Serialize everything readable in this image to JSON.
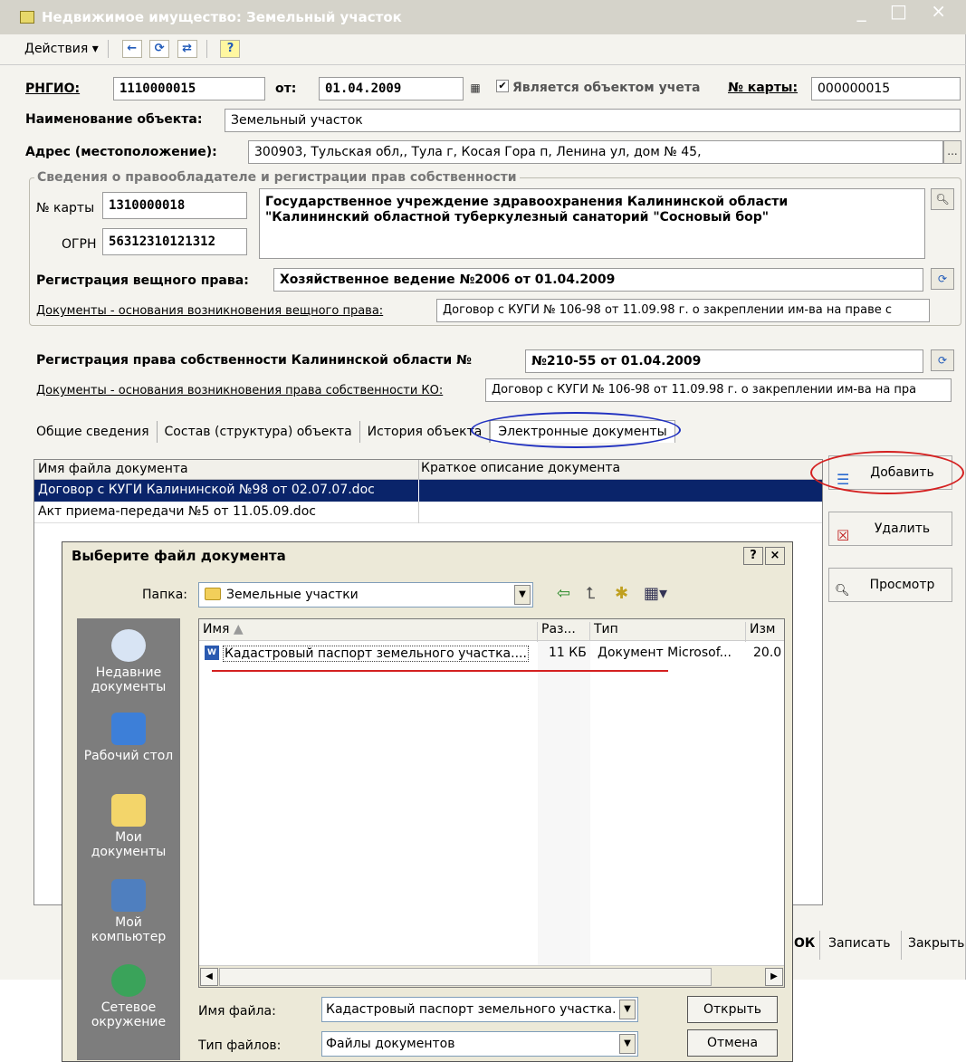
{
  "window": {
    "title": "Недвижимое имущество: Земельный участок",
    "controls": "_ □ ×",
    "actions_menu": "Действия ▾"
  },
  "header": {
    "rngio_label": "РНГИО:",
    "rngio_value": "1110000015",
    "from_label": "от:",
    "date_value": "01.04.2009",
    "accounting_checkbox": "Является объектом учета",
    "card_label": "№ карты:",
    "card_value": "000000015",
    "name_label": "Наименование объекта:",
    "name_value": "Земельный участок",
    "address_label": "Адрес (местоположение):",
    "address_value": "300903, Тульская обл,, Тула г, Косая Гора п, Ленина ул, дом № 45,",
    "ellipsis": "..."
  },
  "rightholder": {
    "legend": "Сведения о правообладателе и регистрации прав собственности",
    "card_label": "№ карты",
    "card_value": "1310000018",
    "ogrn_label": "ОГРН",
    "ogrn_value": "56312310121312",
    "org_line1": "Государственное учреждение здравоохранения Калининской области",
    "org_line2": "\"Калининский областной туберкулезный санаторий \"Сосновый бор\"",
    "real_right_label": "Регистрация вещного права:",
    "real_right_value": "Хозяйственное ведение №2006 от 01.04.2009",
    "docs_real_label": "Документы - основания возникновения вещного права:",
    "docs_real_value": "Договор с КУГИ № 106-98 от 11.09.98 г. о закреплении им-ва на праве с"
  },
  "ownership": {
    "label": "Регистрация права собственности Калининской области №",
    "value": "№210-55 от 01.04.2009",
    "docs_label": "Документы - основания возникновения права собственности КО:",
    "docs_value": "Договор с КУГИ № 106-98 от 11.09.98 г. о закреплении им-ва на пра"
  },
  "tabs": [
    "Общие сведения",
    "Состав (структура) объекта",
    "История объекта",
    "Электронные документы"
  ],
  "table": {
    "columns": [
      "Имя файла документа",
      "Краткое описание документа"
    ],
    "rows": [
      [
        "Договор с КУГИ Калининской №98 от 02.07.07.doc",
        ""
      ],
      [
        "Акт приема-передачи №5 от 11.05.09.doc",
        ""
      ]
    ]
  },
  "side_buttons": {
    "add": "Добавить",
    "delete": "Удалить",
    "view": "Просмотр"
  },
  "bottom_buttons": {
    "ok": "ОК",
    "save": "Записать",
    "close": "Закрыть"
  },
  "dialog": {
    "title": "Выберите файл документа",
    "help": "?",
    "close": "×",
    "folder_label": "Папка:",
    "folder_value": "Земельные участки",
    "places": [
      "Недавние документы",
      "Рабочий стол",
      "Мои документы",
      "Мой компьютер",
      "Сетевое окружение"
    ],
    "columns": [
      "Имя",
      "Раз...",
      "Тип",
      "Изм"
    ],
    "file": {
      "name": "Кадастровый паспорт земельного участка....",
      "size": "11 КБ",
      "type": "Документ Microsof...",
      "modified": "20.0"
    },
    "filename_label": "Имя файла:",
    "filename_value": "Кадастровый паспорт земельного участка.",
    "filetype_label": "Тип файлов:",
    "filetype_value": "Файлы документов",
    "open_button": "Открыть",
    "cancel_button": "Отмена"
  },
  "colors": {
    "selection": "#0a246a",
    "annotation_red": "#d42020",
    "annotation_blue": "#2030c0"
  }
}
